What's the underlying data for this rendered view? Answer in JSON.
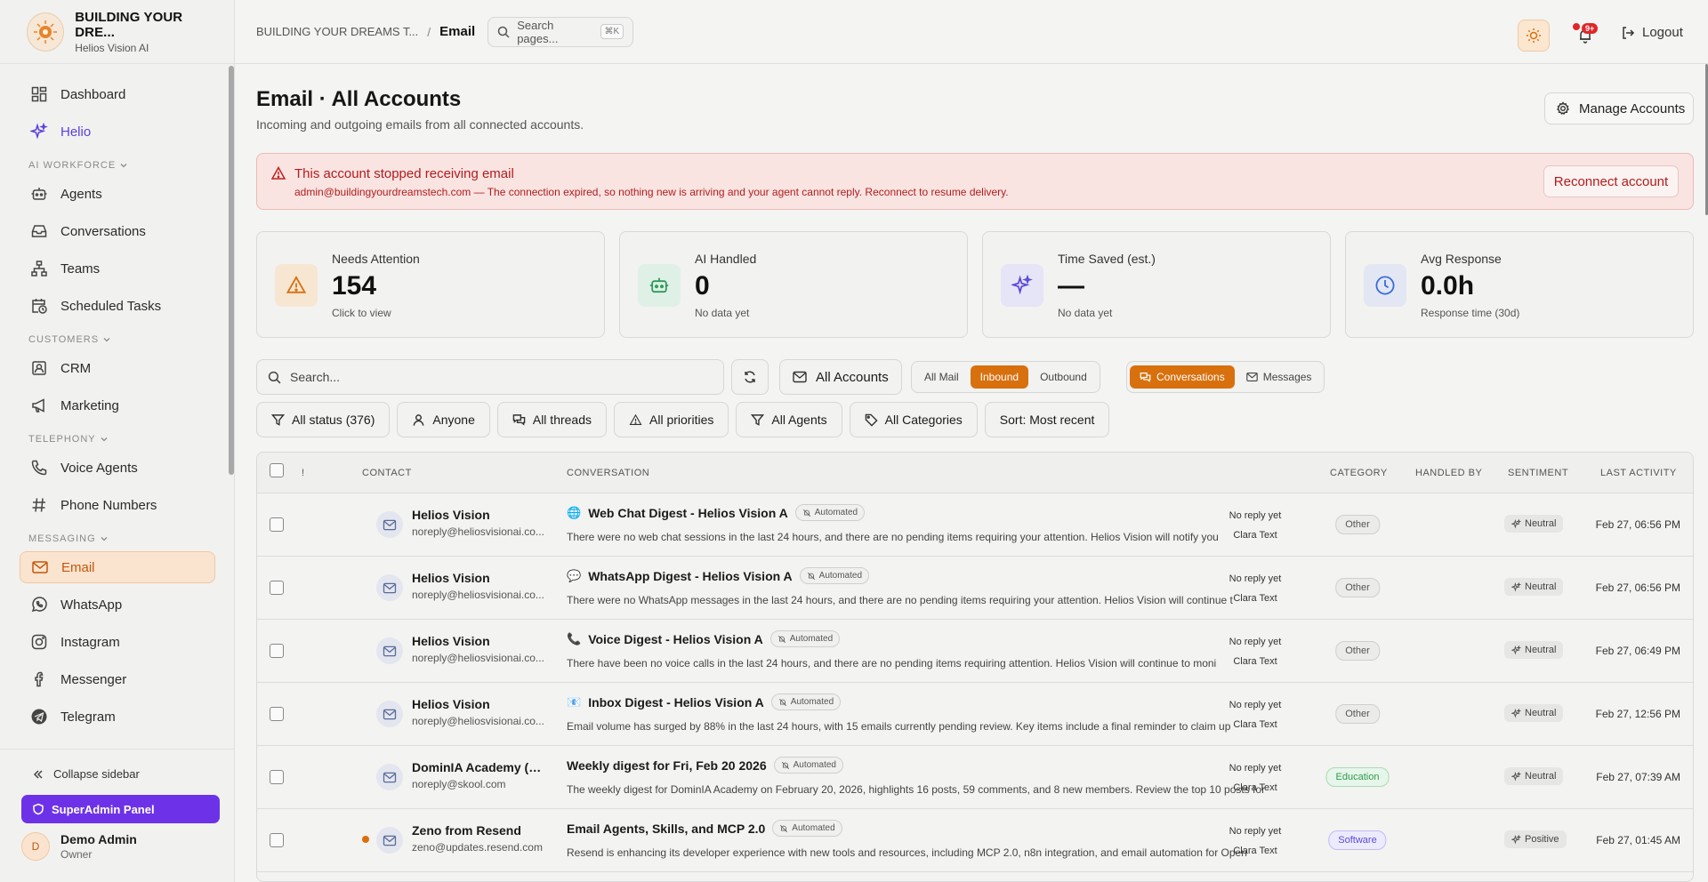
{
  "brand": {
    "title": "BUILDING YOUR DRE...",
    "subtitle": "Helios Vision AI"
  },
  "sidebar": {
    "items": [
      {
        "label": "Dashboard",
        "icon": "dashboard-icon"
      },
      {
        "label": "Helio",
        "icon": "sparkle-icon"
      }
    ],
    "sections": [
      {
        "label": "AI WORKFORCE",
        "items": [
          {
            "label": "Agents",
            "icon": "robot-icon"
          },
          {
            "label": "Conversations",
            "icon": "inbox-icon"
          },
          {
            "label": "Teams",
            "icon": "network-icon"
          },
          {
            "label": "Scheduled Tasks",
            "icon": "calendar-clock-icon"
          }
        ]
      },
      {
        "label": "CUSTOMERS",
        "items": [
          {
            "label": "CRM",
            "icon": "contact-icon"
          },
          {
            "label": "Marketing",
            "icon": "megaphone-icon"
          }
        ]
      },
      {
        "label": "TELEPHONY",
        "items": [
          {
            "label": "Voice Agents",
            "icon": "phone-icon"
          },
          {
            "label": "Phone Numbers",
            "icon": "hash-icon"
          }
        ]
      },
      {
        "label": "MESSAGING",
        "items": [
          {
            "label": "Email",
            "icon": "mail-icon",
            "active": true
          },
          {
            "label": "WhatsApp",
            "icon": "whatsapp-icon"
          },
          {
            "label": "Instagram",
            "icon": "instagram-icon"
          },
          {
            "label": "Messenger",
            "icon": "facebook-icon"
          },
          {
            "label": "Telegram",
            "icon": "telegram-icon"
          }
        ]
      }
    ],
    "collapse_label": "Collapse sidebar",
    "superadmin_label": "SuperAdmin Panel",
    "user": {
      "initial": "D",
      "name": "Demo Admin",
      "role": "Owner"
    }
  },
  "topbar": {
    "breadcrumb_parent": "BUILDING YOUR DREAMS T...",
    "breadcrumb_current": "Email",
    "search_placeholder": "Search pages...",
    "search_shortcut": "⌘K",
    "notification_count": "9+",
    "logout_label": "Logout"
  },
  "page": {
    "title": "Email · All Accounts",
    "subtitle": "Incoming and outgoing emails from all connected accounts.",
    "manage_label": "Manage Accounts"
  },
  "alert": {
    "title": "This account stopped receiving email",
    "message": "admin@buildingyourdreamstech.com — The connection expired, so nothing new is arriving and your agent cannot reply. Reconnect to resume delivery.",
    "action": "Reconnect account"
  },
  "stats": [
    {
      "label": "Needs Attention",
      "value": "154",
      "note": "Click to view",
      "icon": "warning-icon",
      "bg": "#f7e6d2",
      "color": "#d8700d"
    },
    {
      "label": "AI Handled",
      "value": "0",
      "note": "No data yet",
      "icon": "robot-icon",
      "bg": "#dff1e6",
      "color": "#2e9a5a"
    },
    {
      "label": "Time Saved (est.)",
      "value": "—",
      "note": "No data yet",
      "icon": "sparkle-icon",
      "bg": "#e6e4f7",
      "color": "#5b4ad8"
    },
    {
      "label": "Avg Response",
      "value": "0.0h",
      "note": "Response time (30d)",
      "icon": "clock-icon",
      "bg": "#e2e7f3",
      "color": "#3b6bd8"
    }
  ],
  "toolbar": {
    "search_placeholder": "Search...",
    "accounts_label": "All Accounts",
    "mail_filter": [
      "All Mail",
      "Inbound",
      "Outbound"
    ],
    "mail_filter_active": "Inbound",
    "view_filter": [
      "Conversations",
      "Messages"
    ],
    "view_filter_active": "Conversations"
  },
  "filters": [
    {
      "label": "All status (376)",
      "icon": "filter-icon"
    },
    {
      "label": "Anyone",
      "icon": "user-icon"
    },
    {
      "label": "All threads",
      "icon": "threads-icon"
    },
    {
      "label": "All priorities",
      "icon": "warning-icon"
    },
    {
      "label": "All Agents",
      "icon": "filter-icon"
    },
    {
      "label": "All Categories",
      "icon": "tag-icon"
    },
    {
      "label": "Sort: Most recent",
      "icon": ""
    }
  ],
  "table": {
    "headers": {
      "priority": "!",
      "contact": "CONTACT",
      "conversation": "CONVERSATION",
      "category": "CATEGORY",
      "handled_by": "HANDLED BY",
      "sentiment": "SENTIMENT",
      "last_activity": "LAST ACTIVITY"
    },
    "rows": [
      {
        "name": "Helios Vision",
        "email": "noreply@heliosvisionai.co...",
        "emoji": "🌐",
        "subject": "Web Chat Digest - Helios Vision A",
        "badge": "Automated",
        "preview": "There were no web chat sessions in the last 24 hours, and there are no pending items requiring your attention. Helios Vision will notify you",
        "category": "Other",
        "cat_style": "",
        "handled": "No reply yet",
        "agent": "Clara Text",
        "sentiment": "Neutral",
        "time": "Feb 27, 06:56 PM",
        "unread": false
      },
      {
        "name": "Helios Vision",
        "email": "noreply@heliosvisionai.co...",
        "emoji": "💬",
        "subject": "WhatsApp Digest - Helios Vision A",
        "badge": "Automated",
        "preview": "There were no WhatsApp messages in the last 24 hours, and there are no pending items requiring your attention. Helios Vision will continue t",
        "category": "Other",
        "cat_style": "",
        "handled": "No reply yet",
        "agent": "Clara Text",
        "sentiment": "Neutral",
        "time": "Feb 27, 06:56 PM",
        "unread": false
      },
      {
        "name": "Helios Vision",
        "email": "noreply@heliosvisionai.co...",
        "emoji": "📞",
        "subject": "Voice Digest - Helios Vision A",
        "badge": "Automated",
        "preview": "There have been no voice calls in the last 24 hours, and there are no pending items requiring attention. Helios Vision will continue to moni",
        "category": "Other",
        "cat_style": "",
        "handled": "No reply yet",
        "agent": "Clara Text",
        "sentiment": "Neutral",
        "time": "Feb 27, 06:49 PM",
        "unread": false
      },
      {
        "name": "Helios Vision",
        "email": "noreply@heliosvisionai.co...",
        "emoji": "📧",
        "subject": "Inbox Digest - Helios Vision A",
        "badge": "Automated",
        "preview": "Email volume has surged by 88% in the last 24 hours, with 15 emails currently pending review. Key items include a final reminder to claim up",
        "category": "Other",
        "cat_style": "",
        "handled": "No reply yet",
        "agent": "Clara Text",
        "sentiment": "Neutral",
        "time": "Feb 27, 12:56 PM",
        "unread": false
      },
      {
        "name": "DominIA Academy (S...",
        "email": "noreply@skool.com",
        "emoji": "",
        "subject": "Weekly digest for Fri, Feb 20 2026",
        "badge": "Automated",
        "preview": "The weekly digest for DominIA Academy on February 20, 2026, highlights 16 posts, 59 comments, and 8 new members. Review the top 10 posts for",
        "category": "Education",
        "cat_style": "edu",
        "handled": "No reply yet",
        "agent": "Clara Text",
        "sentiment": "Neutral",
        "time": "Feb 27, 07:39 AM",
        "unread": false
      },
      {
        "name": "Zeno from Resend",
        "email": "zeno@updates.resend.com",
        "emoji": "",
        "subject": "Email Agents, Skills, and MCP 2.0",
        "badge": "Automated",
        "preview": "Resend is enhancing its developer experience with new tools and resources, including MCP 2.0, n8n integration, and email automation for Open",
        "category": "Software",
        "cat_style": "soft",
        "handled": "No reply yet",
        "agent": "Clara Text",
        "sentiment": "Positive",
        "time": "Feb 27, 01:45 AM",
        "unread": true
      }
    ]
  }
}
